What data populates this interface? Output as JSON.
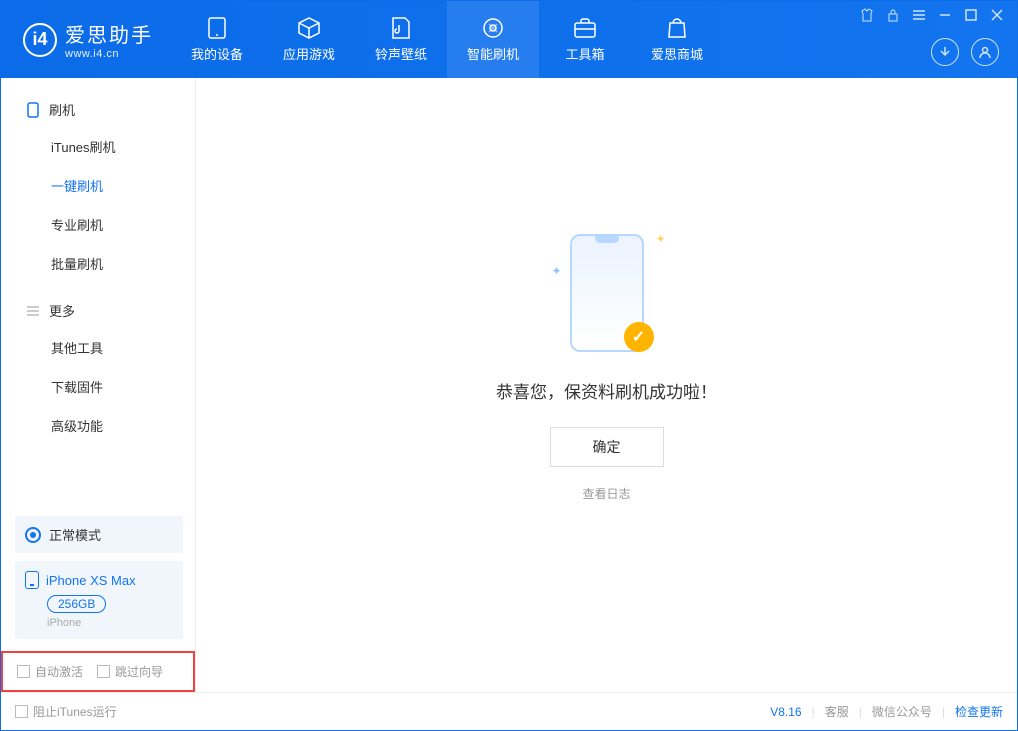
{
  "app": {
    "name": "爱思助手",
    "url": "www.i4.cn"
  },
  "nav": [
    "我的设备",
    "应用游戏",
    "铃声壁纸",
    "智能刷机",
    "工具箱",
    "爱思商城"
  ],
  "nav_active_index": 3,
  "sidebar": {
    "section1_title": "刷机",
    "section1_items": [
      "iTunes刷机",
      "一键刷机",
      "专业刷机",
      "批量刷机"
    ],
    "section1_active_index": 1,
    "section2_title": "更多",
    "section2_items": [
      "其他工具",
      "下载固件",
      "高级功能"
    ]
  },
  "mode_label": "正常模式",
  "device": {
    "name": "iPhone XS Max",
    "capacity": "256GB",
    "type": "iPhone"
  },
  "checkboxes": {
    "auto_activate": "自动激活",
    "skip_guide": "跳过向导"
  },
  "main": {
    "success_text": "恭喜您，保资料刷机成功啦！",
    "ok_label": "确定",
    "log_link": "查看日志"
  },
  "footer": {
    "stop_itunes": "阻止iTunes运行",
    "version": "V8.16",
    "links": [
      "客服",
      "微信公众号",
      "检查更新"
    ]
  }
}
